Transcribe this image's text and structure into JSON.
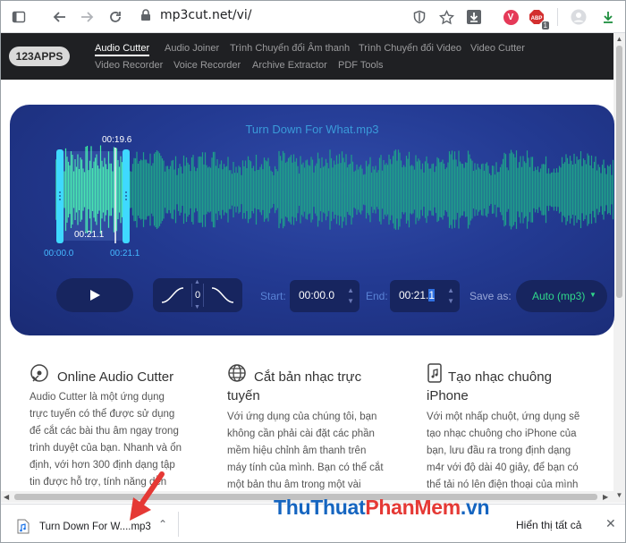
{
  "browser": {
    "url": "mp3cut.net/vi/",
    "profile_letter": "V",
    "badge_count": "1"
  },
  "site": {
    "logo": "123APPS",
    "nav": [
      {
        "label": "Audio Cutter",
        "active": true
      },
      {
        "label": "Audio Joiner"
      },
      {
        "label": "Trình Chuyển đổi Âm thanh"
      },
      {
        "label": "Trình Chuyển đổi Video"
      },
      {
        "label": "Video Cutter"
      },
      {
        "label": "Video Recorder"
      },
      {
        "label": "Voice Recorder"
      },
      {
        "label": "Archive Extractor"
      },
      {
        "label": "PDF Tools"
      }
    ]
  },
  "editor": {
    "file_name": "Turn Down For What.mp3",
    "selection_length": "00:19.6",
    "cursor_time": "00:21.1",
    "range_start_label": "00:00.0",
    "range_end_label": "00:21.1",
    "fade_value": "0",
    "start_label": "Start:",
    "start_value": "00:00.0",
    "end_label": "End:",
    "end_value": "00:21.",
    "end_value_highlight": "1",
    "save_as_label": "Save as:",
    "save_as_value": "Auto (mp3)"
  },
  "features": [
    {
      "title": "Online Audio Cutter",
      "icon": "cd-scissors-icon",
      "body": [
        "Audio Cutter là một ứng dụng",
        "trực tuyến có thể được sử dụng",
        "để cắt các bài thu âm ngay trong",
        "trình duyệt của bạn. Nhanh và ổn",
        "định, với hơn 300 định dạng tập",
        "tin được hỗ trợ, tính năng dễn"
      ]
    },
    {
      "title": [
        "Cắt bản nhạc trực",
        "tuyến"
      ],
      "icon": "globe-icon",
      "body": [
        "Với ứng dụng của chúng tôi, bạn",
        "không cần phải cài đặt các phần",
        "mềm hiệu chỉnh âm thanh trên",
        "máy tính của mình. Bạn có thể cắt",
        "một bản thu âm trong một vài"
      ]
    },
    {
      "title": [
        "Tạo nhạc chuông",
        "iPhone"
      ],
      "icon": "phone-music-icon",
      "body": [
        "Với một nhấp chuột, ứng dụng sẽ",
        "tạo nhạc chuông cho iPhone của",
        "bạn, lưu đầu ra trong định dạng",
        "m4r với độ dài 40 giây, để bạn có",
        "thể tải nó lên điện thoại của mình"
      ]
    }
  ],
  "download_bar": {
    "file_name": "Turn Down For W....mp3",
    "show_all": "Hiển thị tất cả"
  },
  "watermark": {
    "part_a": "ThuThuat",
    "part_b": "PhanMem",
    "part_c": ".vn"
  }
}
